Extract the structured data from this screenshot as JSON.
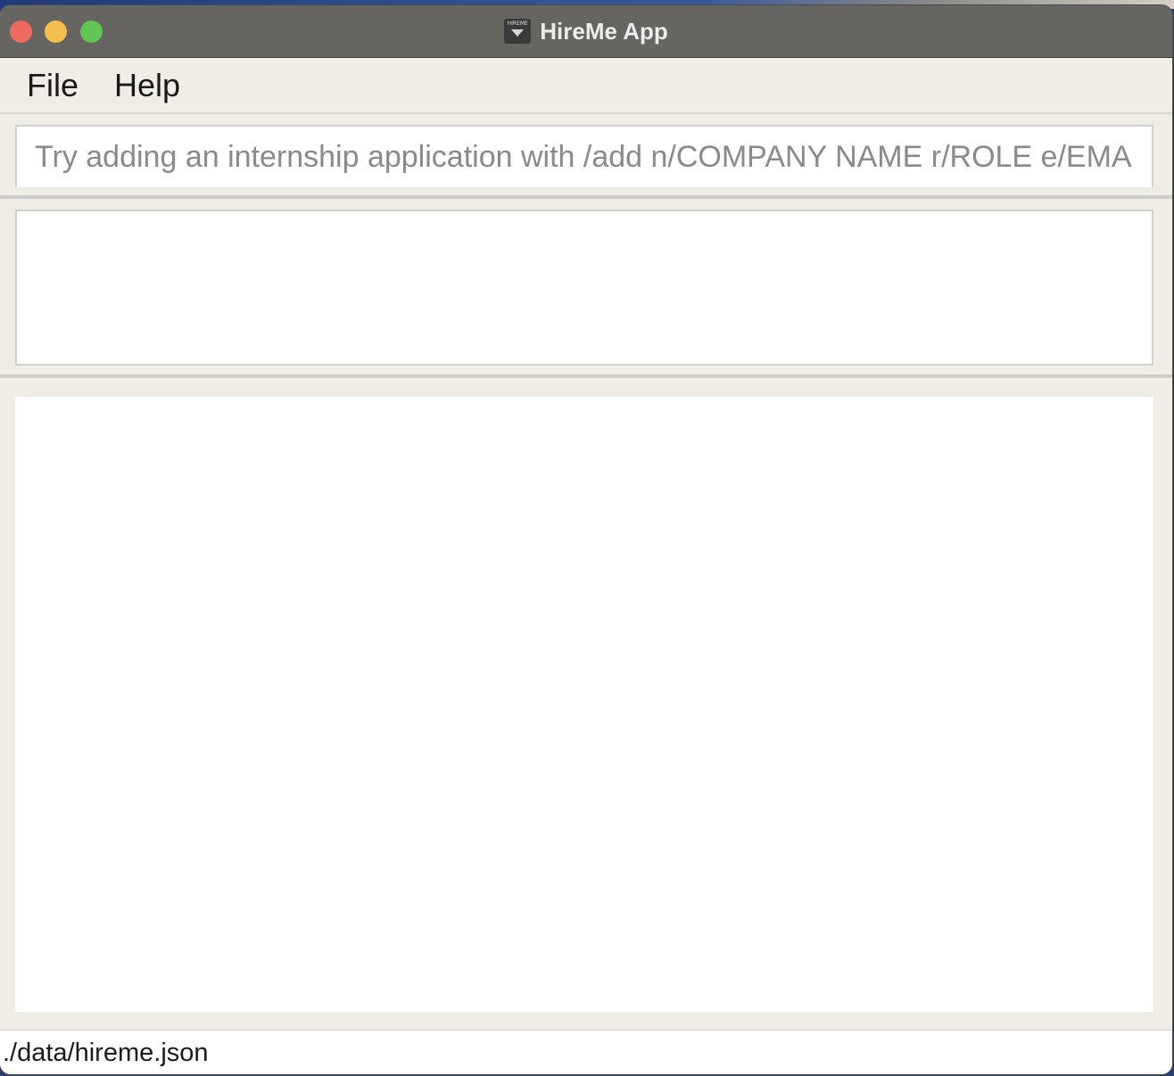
{
  "window": {
    "title": "HireMe App",
    "app_icon": "hireme-app-icon",
    "app_icon_text": "HIREME"
  },
  "menu": {
    "items": [
      {
        "label": "File"
      },
      {
        "label": "Help"
      }
    ]
  },
  "command": {
    "value": "",
    "placeholder": "Try adding an internship application with /add n/COMPANY NAME r/ROLE e/EMAIL d/"
  },
  "result": {
    "text": ""
  },
  "status": {
    "path": "./data/hireme.json"
  },
  "colors": {
    "titlebar": "#666562",
    "background": "#f0ece6",
    "close": "#ec6a5e",
    "minimize": "#f4bf4f",
    "maximize": "#61c554"
  }
}
